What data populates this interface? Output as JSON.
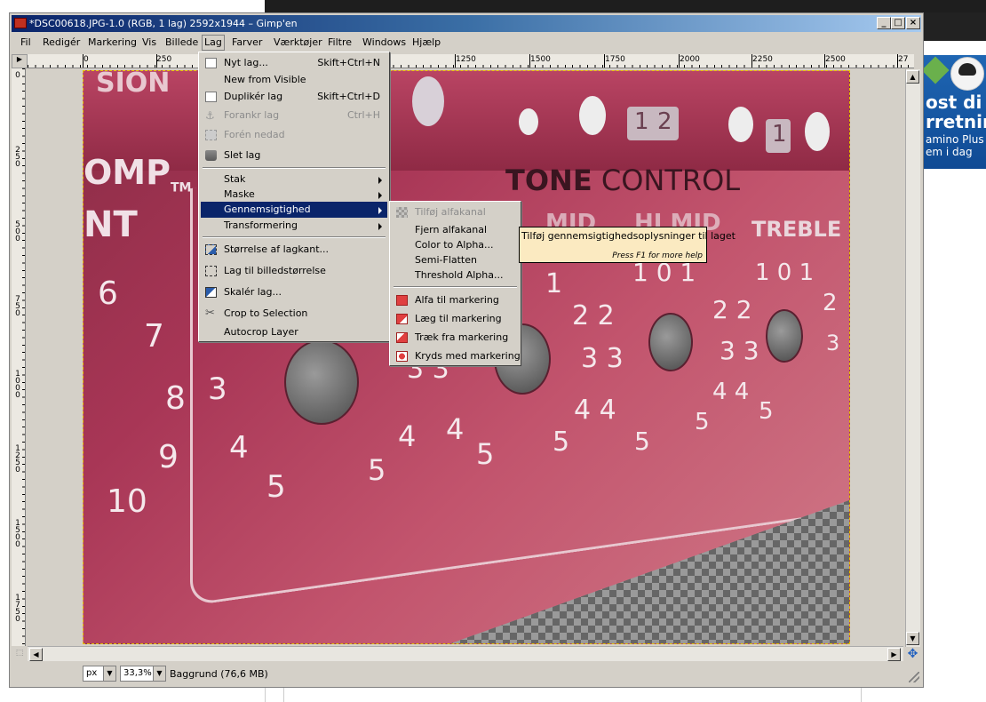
{
  "window": {
    "title": "*DSC00618.JPG-1.0 (RGB, 1 lag) 2592x1944 – Gimp'en",
    "minimize": "_",
    "maximize": "□",
    "close": "×"
  },
  "menubar": [
    "Fil",
    "Redigér",
    "Markering",
    "Vis",
    "Billede",
    "Lag",
    "Farver",
    "Værktøjer",
    "Filtre",
    "Windows",
    "Hjælp"
  ],
  "ruler": {
    "top_labels": [
      "0",
      "250",
      "1250",
      "1500",
      "1750",
      "2000",
      "2250",
      "2500",
      "27"
    ],
    "left_labels": [
      "0",
      "250",
      "500",
      "750",
      "1000",
      "1250",
      "1500",
      "1750"
    ]
  },
  "lag_menu": {
    "items": [
      {
        "label": "Nyt lag...",
        "shortcut": "Skift+Ctrl+N",
        "icon": "new-layer-icon"
      },
      {
        "label": "New from Visible",
        "shortcut": "",
        "icon": ""
      },
      {
        "label": "Duplikér lag",
        "shortcut": "Skift+Ctrl+D",
        "icon": "duplicate-icon"
      },
      {
        "label": "Forankr lag",
        "shortcut": "Ctrl+H",
        "icon": "anchor-icon",
        "disabled": true
      },
      {
        "label": "Forén nedad",
        "shortcut": "",
        "icon": "merge-down-icon",
        "disabled": true
      },
      {
        "label": "Slet lag",
        "shortcut": "",
        "icon": "trash-icon"
      },
      {
        "label": "Stak",
        "submenu": true
      },
      {
        "label": "Maske",
        "submenu": true
      },
      {
        "label": "Gennemsigtighed",
        "submenu": true,
        "selected": true
      },
      {
        "label": "Transformering",
        "submenu": true
      },
      {
        "label": "Størrelse af lagkant...",
        "icon": "resize-icon"
      },
      {
        "label": "Lag til billedstørrelse",
        "icon": "fit-icon"
      },
      {
        "label": "Skalér lag...",
        "icon": "scale-icon"
      },
      {
        "label": "Crop to Selection",
        "icon": "crop-icon"
      },
      {
        "label": "Autocrop Layer",
        "icon": ""
      }
    ]
  },
  "transparency_menu": {
    "items": [
      {
        "label": "Tilføj alfakanal",
        "disabled": true
      },
      {
        "label": "Fjern alfakanal"
      },
      {
        "label": "Color to Alpha..."
      },
      {
        "label": "Semi-Flatten"
      },
      {
        "label": "Threshold Alpha..."
      },
      {
        "label": "Alfa til markering"
      },
      {
        "label": "Læg til markering"
      },
      {
        "label": "Træk fra markering"
      },
      {
        "label": "Kryds med markering"
      }
    ]
  },
  "tooltip": {
    "text": "Tilføj gennemsigtighedsoplysninger til laget",
    "help": "Press F1 for more help"
  },
  "photo": {
    "panel_title_bold": "TONE",
    "panel_title_light": " CONTROL",
    "left_text": "OMP",
    "tm": "TM",
    "nt": "NT",
    "sion": "SION",
    "mid": "MID",
    "himid": "HI MID",
    "treble": "TREBLE",
    "ch1": "1",
    "ch2": "2"
  },
  "statusbar": {
    "unit": "px",
    "zoom": "33,3%",
    "layer_info": "Baggrund (76,6 MB)"
  },
  "ad": {
    "line1": "ost di",
    "line2": "rretnin",
    "line3": "amino Plus",
    "line4": "em i dag"
  }
}
